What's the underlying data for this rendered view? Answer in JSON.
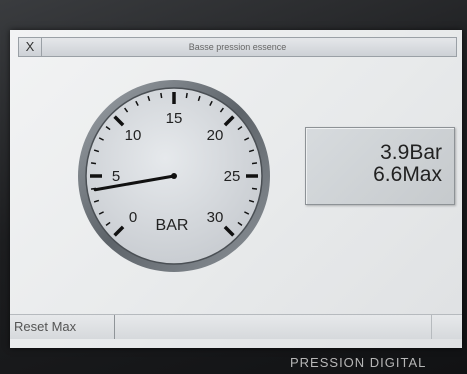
{
  "window": {
    "title": "Basse pression essence",
    "close_label": "X"
  },
  "gauge": {
    "unit_label": "BAR",
    "min": 0,
    "max": 30,
    "major_ticks": [
      "0",
      "5",
      "10",
      "15",
      "20",
      "25",
      "30"
    ],
    "needle_value": 3.9,
    "face_color": "#d8dbdf",
    "ring_color": "#c5c9cd"
  },
  "readout": {
    "current": "3.9Bar",
    "max": "6.6Max"
  },
  "footer": {
    "reset_label": "Reset Max"
  },
  "device_text": "PRESSION DIGITAL"
}
